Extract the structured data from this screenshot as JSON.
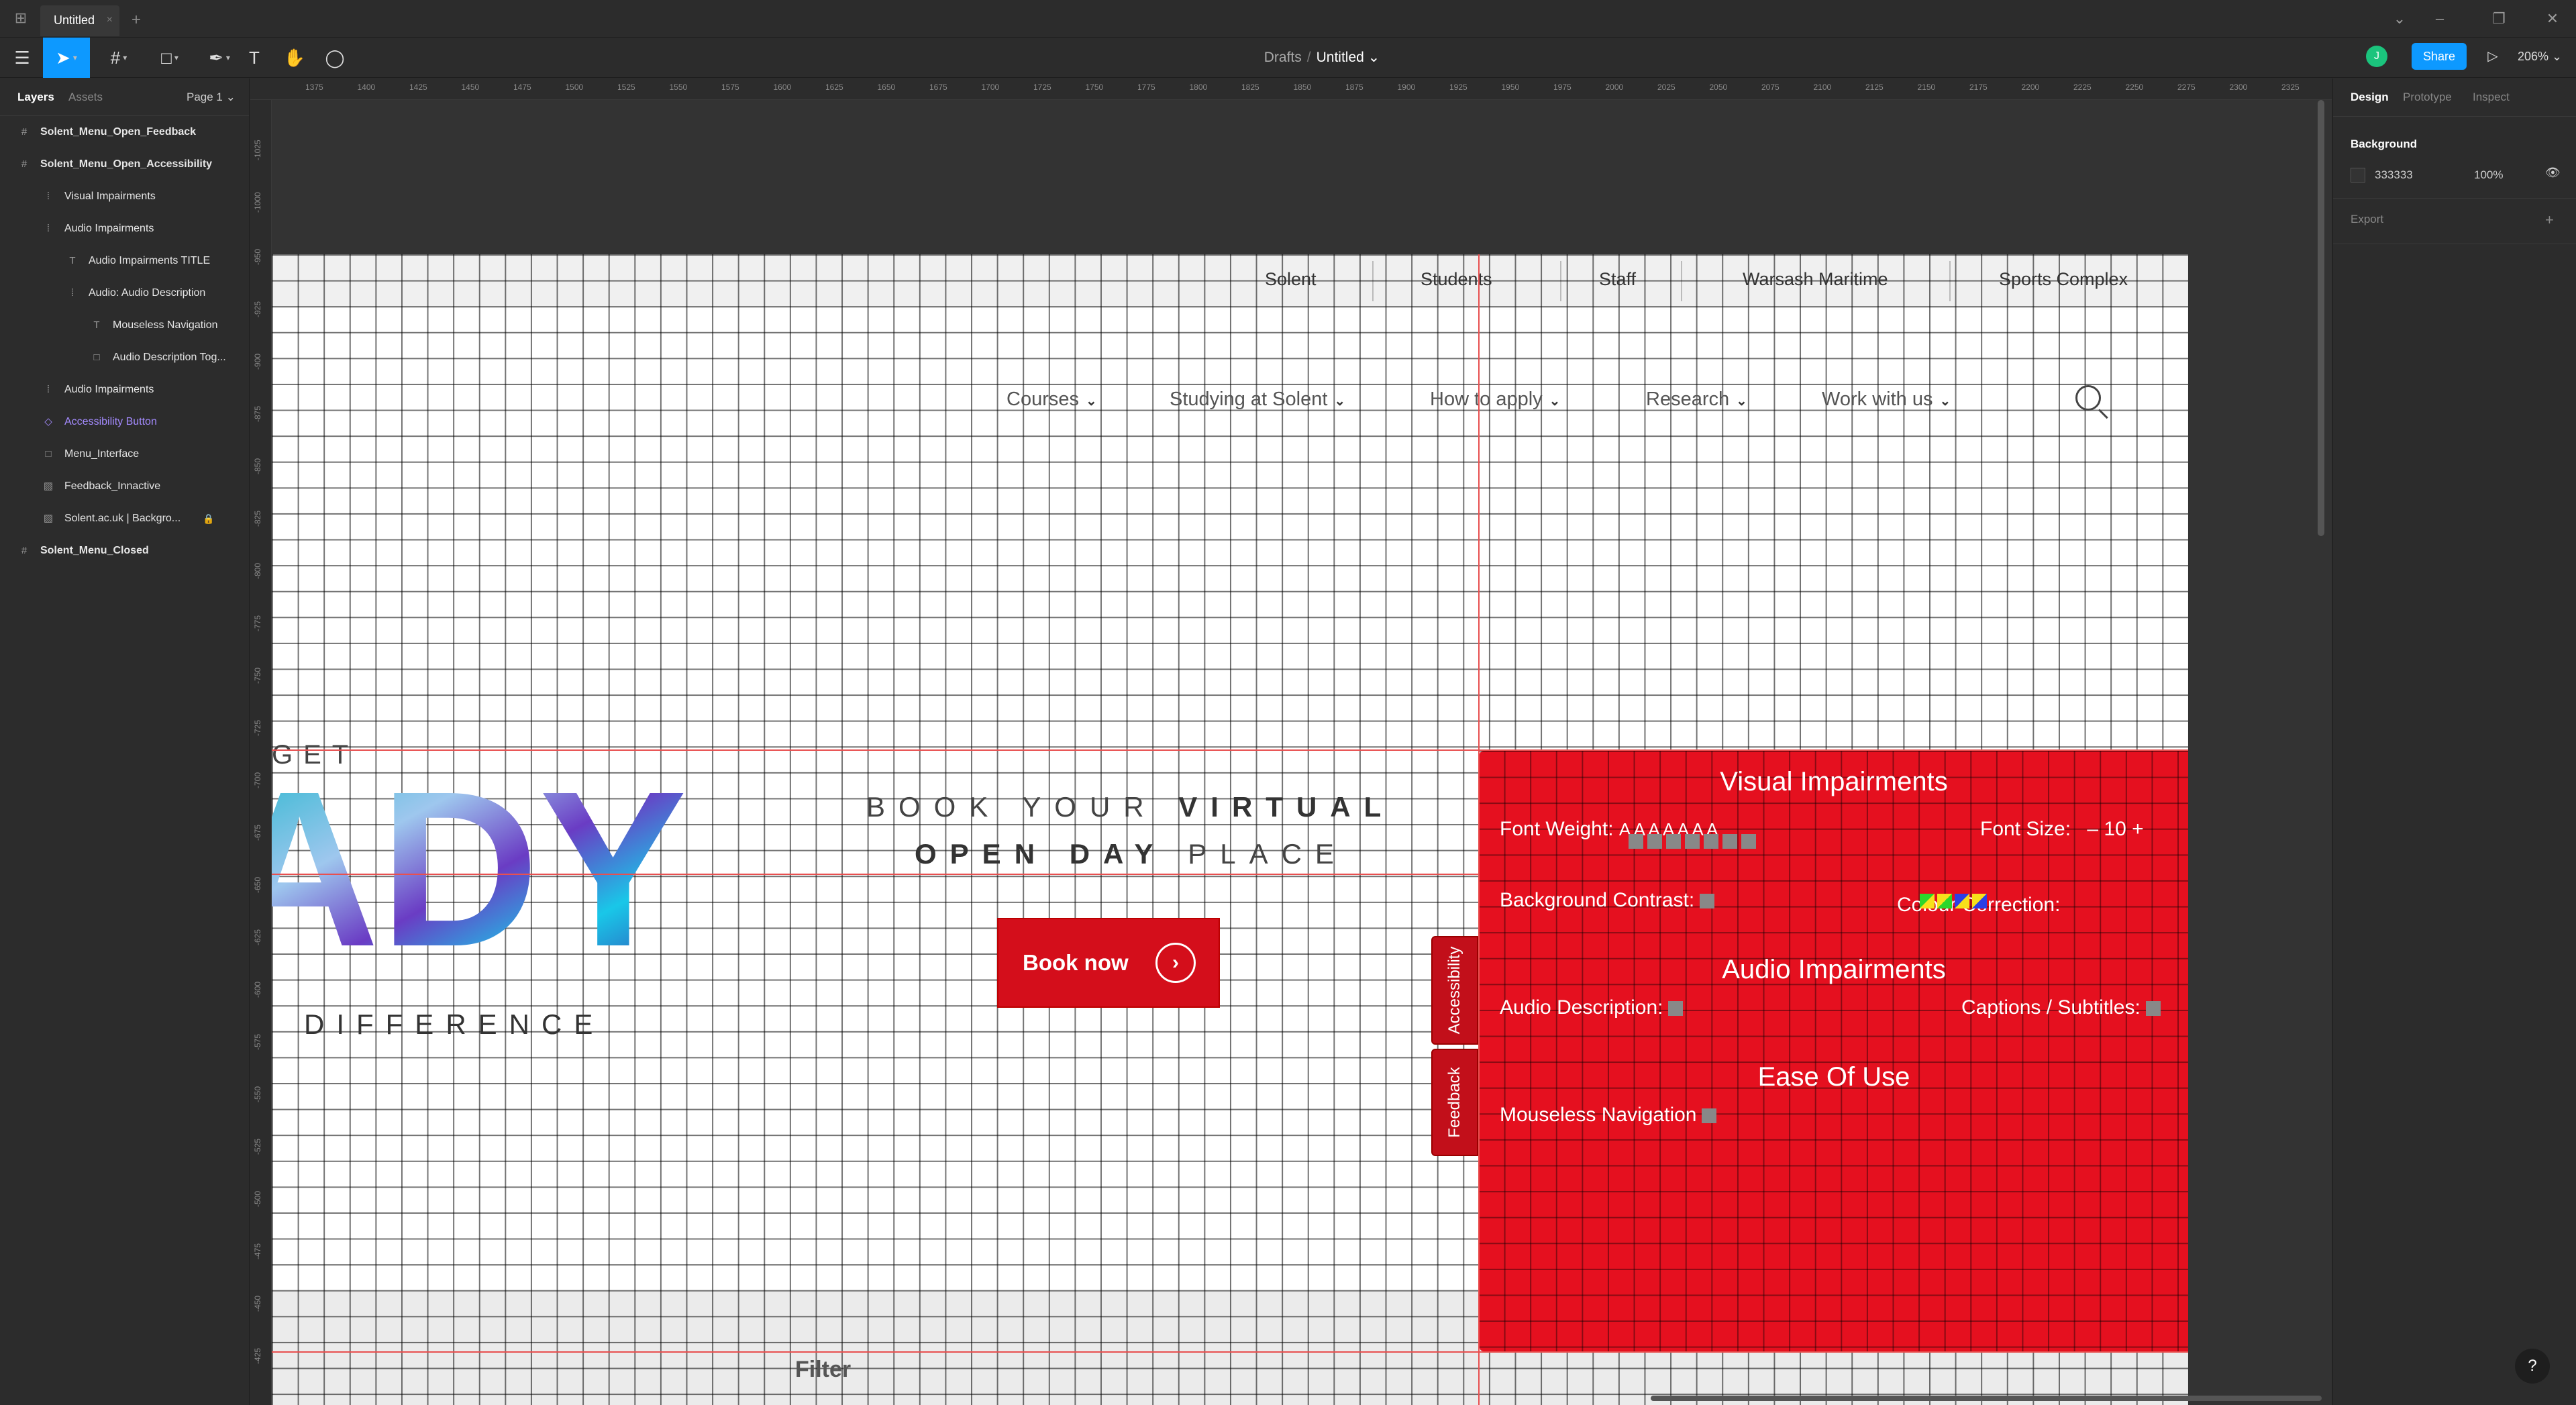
{
  "titlebar": {
    "tab": "Untitled",
    "tab_close": "×",
    "tab_add": "+",
    "min": "–",
    "restore": "❐",
    "close": "✕",
    "expand": "⌄"
  },
  "toolbar": {
    "breadcrumb_drafts": "Drafts",
    "breadcrumb_sep": "/",
    "breadcrumb_file": "Untitled ⌄",
    "avatar": "J",
    "share": "Share",
    "zoom": "206% ⌄"
  },
  "left_panel": {
    "tabs": {
      "layers": "Layers",
      "assets": "Assets",
      "page": "Page 1 ⌄"
    },
    "layers": [
      {
        "label": "Solent_Menu_Open_Feedback",
        "icon": "#"
      },
      {
        "label": "Solent_Menu_Open_Accessibility",
        "icon": "#"
      },
      {
        "label": "Visual Impairments",
        "icon": "⁞"
      },
      {
        "label": "Audio Impairments",
        "icon": "⁞"
      },
      {
        "label": "Audio Impairments TITLE",
        "icon": "T"
      },
      {
        "label": "Audio: Audio Description",
        "icon": "⁞"
      },
      {
        "label": "Mouseless Navigation",
        "icon": "T"
      },
      {
        "label": "Audio Description Tog...",
        "icon": "□"
      },
      {
        "label": "Audio Impairments",
        "icon": "⁞"
      },
      {
        "label": "Accessibility Button",
        "icon": "◇"
      },
      {
        "label": "Menu_Interface",
        "icon": "□"
      },
      {
        "label": "Feedback_Innactive",
        "icon": "▨"
      },
      {
        "label": "Solent.ac.uk | Backgro...",
        "icon": "▨"
      },
      {
        "label": "Solent_Menu_Closed",
        "icon": "#"
      }
    ]
  },
  "right_panel": {
    "tabs": {
      "design": "Design",
      "prototype": "Prototype",
      "inspect": "Inspect"
    },
    "background_title": "Background",
    "background_hex": "333333",
    "background_opacity": "100%",
    "export_title": "Export",
    "background_color": "#333333"
  },
  "rulers": {
    "h": [
      "1375",
      "1400",
      "1425",
      "1450",
      "1475",
      "1500",
      "1525",
      "1550",
      "1575",
      "1600",
      "1625",
      "1650",
      "1675",
      "1700",
      "1725",
      "1750",
      "1775",
      "1800",
      "1825",
      "1850",
      "1875",
      "1900",
      "1925",
      "1950",
      "1975",
      "2000",
      "2025",
      "2050",
      "2075",
      "2100",
      "2125",
      "2150",
      "2175",
      "2200",
      "2225",
      "2250",
      "2275",
      "2300",
      "2325"
    ],
    "v": [
      "-1025",
      "-1000",
      "-950",
      "-925",
      "-900",
      "-875",
      "-850",
      "-825",
      "-800",
      "-775",
      "-750",
      "-725",
      "-700",
      "-675",
      "-650",
      "-625",
      "-600",
      "-575",
      "-550",
      "-525",
      "-500",
      "-475",
      "-450",
      "-425"
    ]
  },
  "site": {
    "top_links": [
      "Solent",
      "Students",
      "Staff",
      "Warsash Maritime",
      "Sports Complex"
    ],
    "nav": [
      "Courses",
      "Studying at Solent",
      "How to apply",
      "Research",
      "Work with us"
    ],
    "hero_get": "GET",
    "hero_big": "ADY",
    "hero_diff": "DIFFERENCE",
    "book_l1a": "BOOK YOUR ",
    "book_l1b": "VIRTUAL",
    "book_l2a": "OPEN DAY",
    "book_l2b": " PLACE",
    "book_now": "Book now",
    "filter": "Filter"
  },
  "accessibility_panel": {
    "visual_title": "Visual Impairments",
    "font_weight_label": "Font Weight:",
    "font_weight_glyphs": "A A A A A A A",
    "font_size_label": "Font Size:",
    "font_size_controls": "– 10 +",
    "background_contrast_label": "Background Contrast:",
    "colour_correction_label": "Colour Correction:",
    "audio_title": "Audio Impairments",
    "audio_description_label": "Audio Description:",
    "captions_label": "Captions / Subtitles:",
    "ease_title": "Ease Of Use",
    "mouseless_label": "Mouseless Navigation",
    "tab_accessibility": "Accessibility",
    "tab_feedback": "Feedback",
    "panel_color": "#e5101f"
  },
  "help": "?"
}
